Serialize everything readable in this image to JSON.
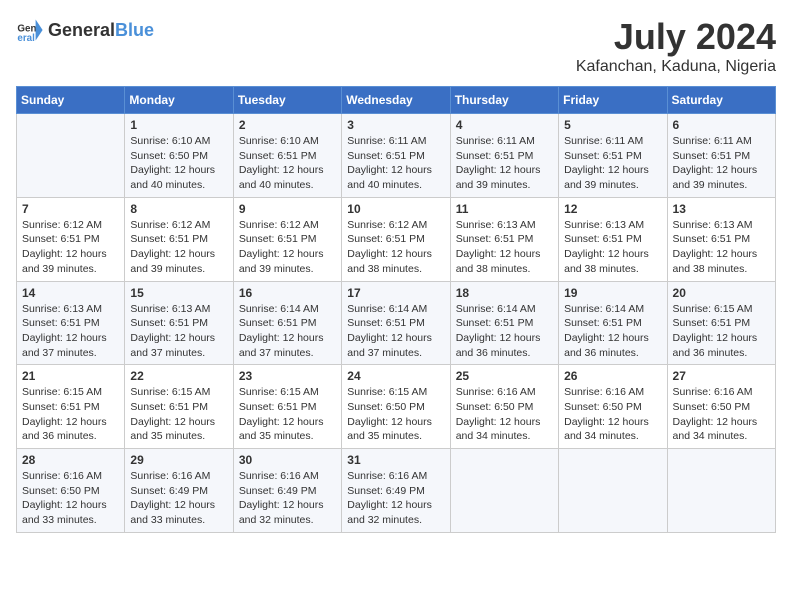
{
  "logo": {
    "general": "General",
    "blue": "Blue"
  },
  "title": "July 2024",
  "subtitle": "Kafanchan, Kaduna, Nigeria",
  "days_of_week": [
    "Sunday",
    "Monday",
    "Tuesday",
    "Wednesday",
    "Thursday",
    "Friday",
    "Saturday"
  ],
  "weeks": [
    [
      {
        "day": "",
        "info": ""
      },
      {
        "day": "1",
        "info": "Sunrise: 6:10 AM\nSunset: 6:50 PM\nDaylight: 12 hours\nand 40 minutes."
      },
      {
        "day": "2",
        "info": "Sunrise: 6:10 AM\nSunset: 6:51 PM\nDaylight: 12 hours\nand 40 minutes."
      },
      {
        "day": "3",
        "info": "Sunrise: 6:11 AM\nSunset: 6:51 PM\nDaylight: 12 hours\nand 40 minutes."
      },
      {
        "day": "4",
        "info": "Sunrise: 6:11 AM\nSunset: 6:51 PM\nDaylight: 12 hours\nand 39 minutes."
      },
      {
        "day": "5",
        "info": "Sunrise: 6:11 AM\nSunset: 6:51 PM\nDaylight: 12 hours\nand 39 minutes."
      },
      {
        "day": "6",
        "info": "Sunrise: 6:11 AM\nSunset: 6:51 PM\nDaylight: 12 hours\nand 39 minutes."
      }
    ],
    [
      {
        "day": "7",
        "info": "Sunrise: 6:12 AM\nSunset: 6:51 PM\nDaylight: 12 hours\nand 39 minutes."
      },
      {
        "day": "8",
        "info": "Sunrise: 6:12 AM\nSunset: 6:51 PM\nDaylight: 12 hours\nand 39 minutes."
      },
      {
        "day": "9",
        "info": "Sunrise: 6:12 AM\nSunset: 6:51 PM\nDaylight: 12 hours\nand 39 minutes."
      },
      {
        "day": "10",
        "info": "Sunrise: 6:12 AM\nSunset: 6:51 PM\nDaylight: 12 hours\nand 38 minutes."
      },
      {
        "day": "11",
        "info": "Sunrise: 6:13 AM\nSunset: 6:51 PM\nDaylight: 12 hours\nand 38 minutes."
      },
      {
        "day": "12",
        "info": "Sunrise: 6:13 AM\nSunset: 6:51 PM\nDaylight: 12 hours\nand 38 minutes."
      },
      {
        "day": "13",
        "info": "Sunrise: 6:13 AM\nSunset: 6:51 PM\nDaylight: 12 hours\nand 38 minutes."
      }
    ],
    [
      {
        "day": "14",
        "info": "Sunrise: 6:13 AM\nSunset: 6:51 PM\nDaylight: 12 hours\nand 37 minutes."
      },
      {
        "day": "15",
        "info": "Sunrise: 6:13 AM\nSunset: 6:51 PM\nDaylight: 12 hours\nand 37 minutes."
      },
      {
        "day": "16",
        "info": "Sunrise: 6:14 AM\nSunset: 6:51 PM\nDaylight: 12 hours\nand 37 minutes."
      },
      {
        "day": "17",
        "info": "Sunrise: 6:14 AM\nSunset: 6:51 PM\nDaylight: 12 hours\nand 37 minutes."
      },
      {
        "day": "18",
        "info": "Sunrise: 6:14 AM\nSunset: 6:51 PM\nDaylight: 12 hours\nand 36 minutes."
      },
      {
        "day": "19",
        "info": "Sunrise: 6:14 AM\nSunset: 6:51 PM\nDaylight: 12 hours\nand 36 minutes."
      },
      {
        "day": "20",
        "info": "Sunrise: 6:15 AM\nSunset: 6:51 PM\nDaylight: 12 hours\nand 36 minutes."
      }
    ],
    [
      {
        "day": "21",
        "info": "Sunrise: 6:15 AM\nSunset: 6:51 PM\nDaylight: 12 hours\nand 36 minutes."
      },
      {
        "day": "22",
        "info": "Sunrise: 6:15 AM\nSunset: 6:51 PM\nDaylight: 12 hours\nand 35 minutes."
      },
      {
        "day": "23",
        "info": "Sunrise: 6:15 AM\nSunset: 6:51 PM\nDaylight: 12 hours\nand 35 minutes."
      },
      {
        "day": "24",
        "info": "Sunrise: 6:15 AM\nSunset: 6:50 PM\nDaylight: 12 hours\nand 35 minutes."
      },
      {
        "day": "25",
        "info": "Sunrise: 6:16 AM\nSunset: 6:50 PM\nDaylight: 12 hours\nand 34 minutes."
      },
      {
        "day": "26",
        "info": "Sunrise: 6:16 AM\nSunset: 6:50 PM\nDaylight: 12 hours\nand 34 minutes."
      },
      {
        "day": "27",
        "info": "Sunrise: 6:16 AM\nSunset: 6:50 PM\nDaylight: 12 hours\nand 34 minutes."
      }
    ],
    [
      {
        "day": "28",
        "info": "Sunrise: 6:16 AM\nSunset: 6:50 PM\nDaylight: 12 hours\nand 33 minutes."
      },
      {
        "day": "29",
        "info": "Sunrise: 6:16 AM\nSunset: 6:49 PM\nDaylight: 12 hours\nand 33 minutes."
      },
      {
        "day": "30",
        "info": "Sunrise: 6:16 AM\nSunset: 6:49 PM\nDaylight: 12 hours\nand 32 minutes."
      },
      {
        "day": "31",
        "info": "Sunrise: 6:16 AM\nSunset: 6:49 PM\nDaylight: 12 hours\nand 32 minutes."
      },
      {
        "day": "",
        "info": ""
      },
      {
        "day": "",
        "info": ""
      },
      {
        "day": "",
        "info": ""
      }
    ]
  ]
}
